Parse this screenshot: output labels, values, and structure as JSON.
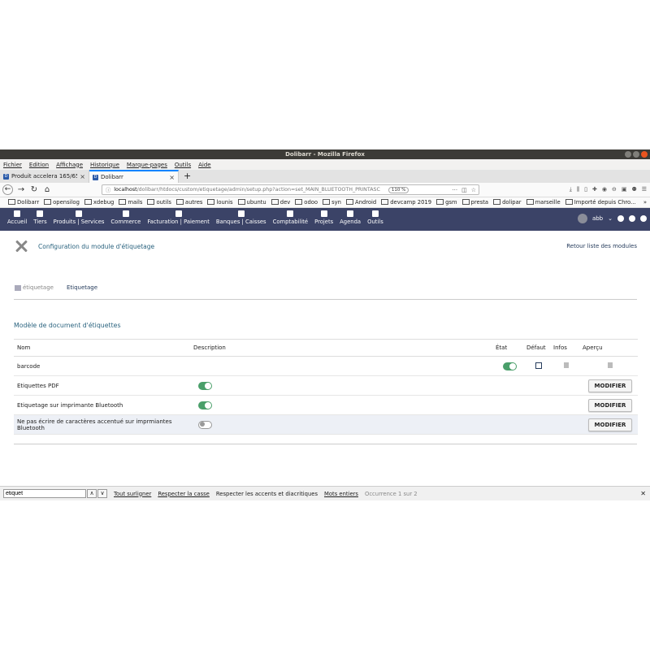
{
  "window": {
    "title": "Dolibarr - Mozilla Firefox"
  },
  "menubar": [
    "Fichier",
    "Edition",
    "Affichage",
    "Historique",
    "Marque-pages",
    "Outils",
    "Aide"
  ],
  "tabs": [
    {
      "title": "Produit accelera 165/65",
      "active": false
    },
    {
      "title": "Dolibarr",
      "active": true
    }
  ],
  "urlbar": {
    "host": "localhost",
    "path": "/dolibarr/htdocs/custom/etiquetage/admin/setup.php?action=set_MAIN_BLUETOOTH_PRINTASC",
    "zoom": "110 %"
  },
  "bookmarks": [
    "Dolibarr",
    "opensilog",
    "xdebug",
    "mails",
    "outils",
    "autres",
    "lounis",
    "ubuntu",
    "dev",
    "odoo",
    "syn",
    "Android",
    "devcamp 2019",
    "gsm",
    "presta",
    "dolipar",
    "marseille",
    "Importé depuis Chro..."
  ],
  "dolnav": {
    "items": [
      "Accueil",
      "Tiers",
      "Produits | Services",
      "Commerce",
      "Facturation | Paiement",
      "Banques | Caisses",
      "Comptabilité",
      "Projets",
      "Agenda",
      "Outils"
    ],
    "user": "abb"
  },
  "page": {
    "title": "Configuration du module d'étiquetage",
    "back_link": "Retour liste des modules",
    "subtabs": [
      "étiquetage",
      "Etiquetage"
    ],
    "section_title": "Modèle de document d'étiquettes"
  },
  "table": {
    "headers": {
      "nom": "Nom",
      "description": "Description",
      "etat": "État",
      "defaut": "Défaut",
      "infos": "Infos",
      "apercu": "Aperçu"
    },
    "barcode": "barcode",
    "rows": [
      {
        "label": "Etiquettes PDF",
        "toggle": "on",
        "button": "MODIFIER"
      },
      {
        "label": "Etiquetage sur imprimante Bluetooth",
        "toggle": "on",
        "button": "MODIFIER"
      },
      {
        "label": "Ne pas écrire de caractères accentué sur imprmiantes Bluetooth",
        "toggle": "off",
        "button": "MODIFIER"
      }
    ]
  },
  "findbar": {
    "value": "etiquet",
    "highlight_all": "Tout surligner",
    "match_case": "Respecter la casse",
    "match_diacritics": "Respecter les accents et diacritiques",
    "whole_words": "Mots entiers",
    "status": "Occurrence 1 sur 2"
  },
  "colors": {
    "dolibarr_nav": "#3b4367",
    "toggle_on": "#4a9f6a",
    "title_teal": "#29627e"
  }
}
